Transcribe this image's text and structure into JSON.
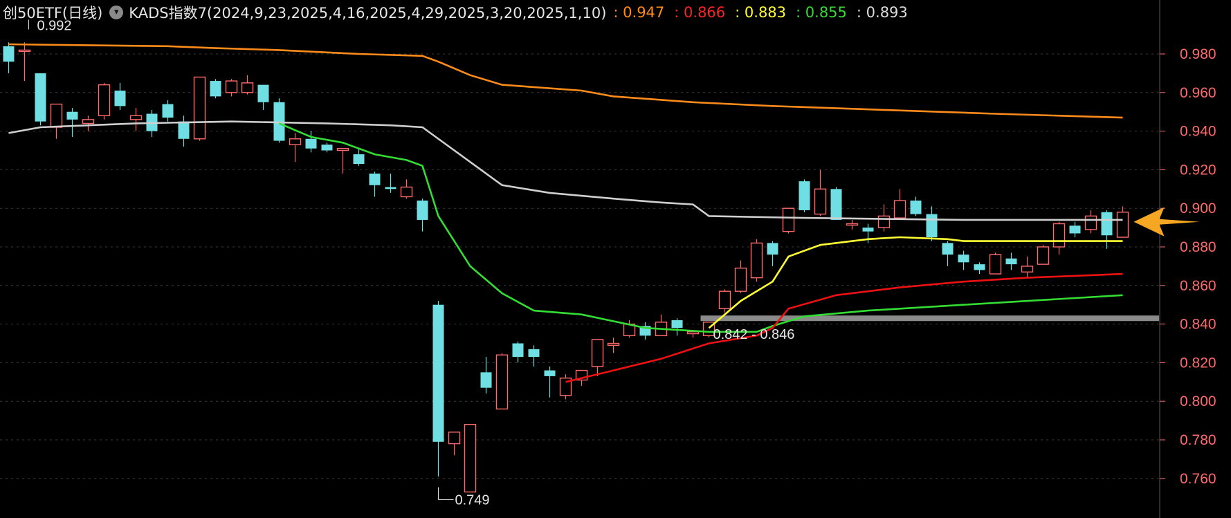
{
  "header": {
    "symbol": "创50ETF(日线)",
    "indicator": "KADS指数7(2024,9,23,2025,4,16,2025,4,29,2025,3,20,2025,1,10)",
    "values": [
      {
        "text": ": 0.947",
        "color": "#ff8c1a"
      },
      {
        "text": ": 0.866",
        "color": "#ff2222"
      },
      {
        "text": ": 0.883",
        "color": "#ffff33"
      },
      {
        "text": ": 0.855",
        "color": "#33dd33"
      },
      {
        "text": ": 0.893",
        "color": "#dddddd"
      }
    ]
  },
  "chart_data": {
    "type": "candlestick",
    "ylim": [
      0.748,
      0.993
    ],
    "yticks": [
      "0.980",
      "0.960",
      "0.940",
      "0.920",
      "0.900",
      "0.880",
      "0.860",
      "0.840",
      "0.820",
      "0.800",
      "0.780",
      "0.760"
    ],
    "grid": true,
    "colors": {
      "up": "#ff6b6b",
      "down": "#6fdfe3",
      "axis": "#ff6b6b",
      "grid": "#3a3a3a"
    },
    "candles": [
      [
        0.984,
        0.986,
        0.97,
        0.976
      ],
      [
        0.982,
        0.986,
        0.966,
        0.982
      ],
      [
        0.97,
        0.97,
        0.943,
        0.945
      ],
      [
        0.942,
        0.952,
        0.936,
        0.954
      ],
      [
        0.95,
        0.952,
        0.937,
        0.946
      ],
      [
        0.944,
        0.948,
        0.94,
        0.946
      ],
      [
        0.948,
        0.965,
        0.946,
        0.964
      ],
      [
        0.961,
        0.965,
        0.951,
        0.953
      ],
      [
        0.946,
        0.952,
        0.94,
        0.948
      ],
      [
        0.949,
        0.951,
        0.937,
        0.94
      ],
      [
        0.954,
        0.956,
        0.945,
        0.947
      ],
      [
        0.945,
        0.948,
        0.932,
        0.936
      ],
      [
        0.936,
        0.968,
        0.935,
        0.968
      ],
      [
        0.966,
        0.967,
        0.957,
        0.958
      ],
      [
        0.96,
        0.967,
        0.958,
        0.966
      ],
      [
        0.96,
        0.969,
        0.959,
        0.965
      ],
      [
        0.964,
        0.964,
        0.951,
        0.955
      ],
      [
        0.955,
        0.957,
        0.934,
        0.935
      ],
      [
        0.933,
        0.939,
        0.924,
        0.936
      ],
      [
        0.936,
        0.94,
        0.929,
        0.931
      ],
      [
        0.933,
        0.934,
        0.929,
        0.93
      ],
      [
        0.93,
        0.931,
        0.918,
        0.931
      ],
      [
        0.928,
        0.931,
        0.922,
        0.923
      ],
      [
        0.918,
        0.919,
        0.906,
        0.912
      ],
      [
        0.911,
        0.918,
        0.908,
        0.91
      ],
      [
        0.906,
        0.915,
        0.905,
        0.911
      ],
      [
        0.904,
        0.905,
        0.888,
        0.894
      ],
      [
        0.85,
        0.852,
        0.761,
        0.779
      ],
      [
        0.778,
        0.782,
        0.772,
        0.784
      ],
      [
        0.753,
        0.784,
        0.756,
        0.788
      ],
      [
        0.815,
        0.823,
        0.804,
        0.807
      ],
      [
        0.796,
        0.825,
        0.796,
        0.824
      ],
      [
        0.83,
        0.831,
        0.82,
        0.823
      ],
      [
        0.827,
        0.829,
        0.818,
        0.823
      ],
      [
        0.816,
        0.818,
        0.802,
        0.813
      ],
      [
        0.803,
        0.814,
        0.801,
        0.812
      ],
      [
        0.811,
        0.813,
        0.808,
        0.816
      ],
      [
        0.818,
        0.832,
        0.813,
        0.832
      ],
      [
        0.829,
        0.833,
        0.825,
        0.83
      ],
      [
        0.834,
        0.842,
        0.833,
        0.84
      ],
      [
        0.839,
        0.841,
        0.832,
        0.834
      ],
      [
        0.834,
        0.845,
        0.834,
        0.841
      ],
      [
        0.842,
        0.843,
        0.834,
        0.838
      ],
      [
        0.835,
        0.836,
        0.833,
        0.836
      ],
      [
        0.834,
        0.841,
        0.833,
        0.841
      ],
      [
        0.848,
        0.858,
        0.846,
        0.857
      ],
      [
        0.857,
        0.873,
        0.856,
        0.869
      ],
      [
        0.864,
        0.884,
        0.862,
        0.882
      ],
      [
        0.882,
        0.883,
        0.87,
        0.876
      ],
      [
        0.888,
        0.9,
        0.887,
        0.9
      ],
      [
        0.914,
        0.915,
        0.898,
        0.899
      ],
      [
        0.897,
        0.92,
        0.896,
        0.91
      ],
      [
        0.91,
        0.911,
        0.894,
        0.894
      ],
      [
        0.892,
        0.894,
        0.889,
        0.892
      ],
      [
        0.89,
        0.892,
        0.882,
        0.888
      ],
      [
        0.89,
        0.902,
        0.888,
        0.896
      ],
      [
        0.895,
        0.91,
        0.894,
        0.904
      ],
      [
        0.904,
        0.906,
        0.896,
        0.897
      ],
      [
        0.897,
        0.901,
        0.883,
        0.885
      ],
      [
        0.882,
        0.883,
        0.87,
        0.876
      ],
      [
        0.876,
        0.878,
        0.868,
        0.872
      ],
      [
        0.871,
        0.872,
        0.866,
        0.868
      ],
      [
        0.866,
        0.877,
        0.866,
        0.876
      ],
      [
        0.874,
        0.877,
        0.868,
        0.871
      ],
      [
        0.867,
        0.875,
        0.864,
        0.87
      ],
      [
        0.871,
        0.881,
        0.871,
        0.88
      ],
      [
        0.88,
        0.893,
        0.876,
        0.892
      ],
      [
        0.891,
        0.893,
        0.885,
        0.887
      ],
      [
        0.889,
        0.899,
        0.887,
        0.896
      ],
      [
        0.898,
        0.899,
        0.879,
        0.886
      ],
      [
        0.885,
        0.901,
        0.885,
        0.898
      ]
    ],
    "series": [
      {
        "color": "#ff8c1a",
        "points": [
          [
            0,
            0.985
          ],
          [
            10,
            0.984
          ],
          [
            13,
            0.983
          ],
          [
            17,
            0.982
          ],
          [
            22,
            0.98
          ],
          [
            26,
            0.979
          ],
          [
            27,
            0.976
          ],
          [
            29,
            0.969
          ],
          [
            31,
            0.964
          ],
          [
            36,
            0.961
          ],
          [
            38,
            0.958
          ],
          [
            43,
            0.955
          ],
          [
            48,
            0.953
          ],
          [
            55,
            0.951
          ],
          [
            62,
            0.949
          ],
          [
            70,
            0.947
          ]
        ]
      },
      {
        "color": "#cfcfcf",
        "points": [
          [
            0,
            0.939
          ],
          [
            2,
            0.942
          ],
          [
            8,
            0.944
          ],
          [
            14,
            0.945
          ],
          [
            20,
            0.944
          ],
          [
            24,
            0.943
          ],
          [
            26,
            0.942
          ],
          [
            29,
            0.924
          ],
          [
            31,
            0.912
          ],
          [
            34,
            0.908
          ],
          [
            38,
            0.905
          ],
          [
            41,
            0.903
          ],
          [
            43,
            0.902
          ],
          [
            44,
            0.896
          ],
          [
            50,
            0.895
          ],
          [
            60,
            0.894
          ],
          [
            70,
            0.894
          ]
        ]
      },
      {
        "color": "#33dd33",
        "points": [
          [
            17,
            0.944
          ],
          [
            19,
            0.937
          ],
          [
            21,
            0.934
          ],
          [
            23,
            0.928
          ],
          [
            25,
            0.925
          ],
          [
            26,
            0.922
          ],
          [
            27,
            0.896
          ],
          [
            29,
            0.87
          ],
          [
            31,
            0.856
          ],
          [
            33,
            0.847
          ],
          [
            36,
            0.845
          ],
          [
            40,
            0.838
          ],
          [
            44,
            0.836
          ],
          [
            47,
            0.836
          ],
          [
            48,
            0.839
          ],
          [
            50,
            0.844
          ],
          [
            54,
            0.847
          ],
          [
            60,
            0.85
          ],
          [
            70,
            0.855
          ]
        ]
      },
      {
        "color": "#ee1111",
        "points": [
          [
            35,
            0.81
          ],
          [
            38,
            0.816
          ],
          [
            41,
            0.822
          ],
          [
            44,
            0.83
          ],
          [
            47,
            0.834
          ],
          [
            48,
            0.838
          ],
          [
            49,
            0.848
          ],
          [
            52,
            0.855
          ],
          [
            56,
            0.859
          ],
          [
            60,
            0.862
          ],
          [
            64,
            0.864
          ],
          [
            70,
            0.866
          ]
        ]
      },
      {
        "color": "#ffff33",
        "points": [
          [
            44,
            0.838
          ],
          [
            46,
            0.852
          ],
          [
            48,
            0.862
          ],
          [
            49,
            0.875
          ],
          [
            51,
            0.881
          ],
          [
            54,
            0.884
          ],
          [
            56,
            0.885
          ],
          [
            59,
            0.884
          ],
          [
            60,
            0.883
          ],
          [
            70,
            0.883
          ]
        ]
      }
    ],
    "band": {
      "y": 0.843,
      "from_index": 44
    },
    "annotations": [
      {
        "text": "0.992",
        "at_index": 1
      },
      {
        "text": "0.749",
        "at_index": 27
      },
      {
        "text": "0.842 - 0.846",
        "at_index": 44
      }
    ]
  }
}
